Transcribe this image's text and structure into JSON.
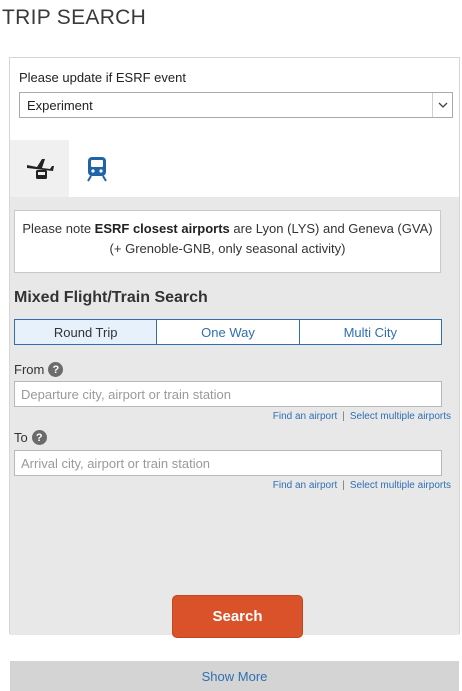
{
  "page": {
    "title": "TRIP SEARCH"
  },
  "event": {
    "label": "Please update if ESRF event",
    "selected": "Experiment"
  },
  "tabs": [
    {
      "name": "flight-train",
      "icon": "plane-train-icon"
    },
    {
      "name": "train",
      "icon": "train-icon"
    }
  ],
  "notice": {
    "prefix": "Please note ",
    "bold": "ESRF closest airports",
    "suffix": " are Lyon (LYS) and Geneva (GVA) (+ Grenoble-GNB, only seasonal activity)"
  },
  "search": {
    "heading": "Mixed Flight/Train Search",
    "trip_types": [
      "Round Trip",
      "One Way",
      "Multi City"
    ],
    "selected_trip_type": "Round Trip",
    "from": {
      "label": "From",
      "placeholder": "Departure city, airport or train station"
    },
    "to": {
      "label": "To",
      "placeholder": "Arrival city, airport or train station"
    },
    "find_airport": "Find an airport",
    "separator": "|",
    "select_multiple": "Select multiple airports",
    "help_glyph": "?",
    "button": "Search",
    "show_more": "Show More"
  },
  "colors": {
    "accent": "#2f6fb3",
    "button": "#d9522a",
    "panel": "#e8e8e8"
  }
}
